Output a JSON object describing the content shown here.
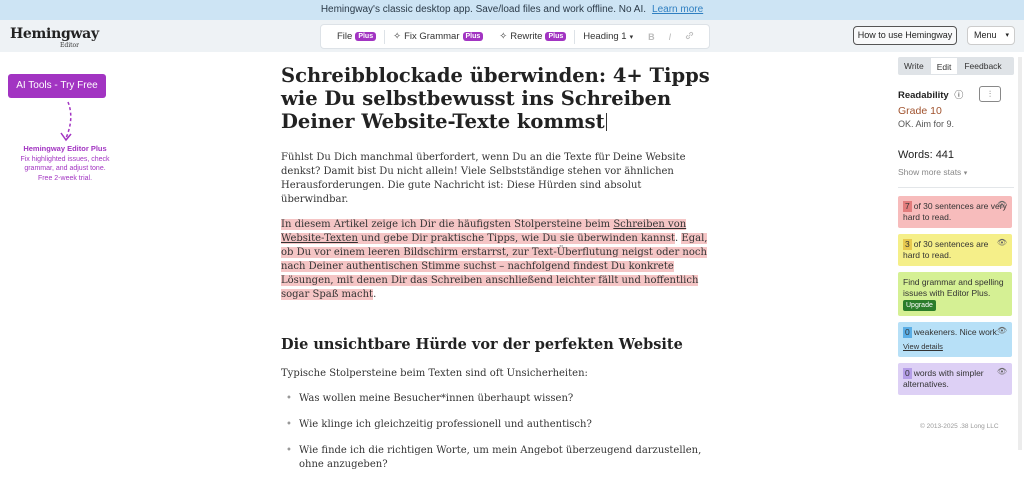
{
  "banner": {
    "text": "Hemingway's classic desktop app. Save/load files and work offline. No AI.",
    "link": "Learn more"
  },
  "logo": {
    "name": "Hemingway",
    "sub": "Editor"
  },
  "toolbar": {
    "file": "File",
    "fix_grammar": "Fix Grammar",
    "rewrite": "Rewrite",
    "plus": "Plus",
    "heading": "Heading 1",
    "bold": "B",
    "italic": "I",
    "link_icon": "link-icon"
  },
  "header": {
    "howto": "How to use Hemingway",
    "menu": "Menu"
  },
  "promo": {
    "button": "AI Tools - Try Free",
    "title": "Hemingway Editor Plus",
    "text": "Fix highlighted issues, check grammar, and adjust tone.",
    "trial": "Free 2-week trial."
  },
  "doc": {
    "title": "Schreibblockade überwinden: 4+ Tipps wie Du selbstbewusst ins Schreiben Deiner Website-Texte kommst",
    "p1": "Fühlst Du Dich manchmal überfordert, wenn Du an die Texte für Deine Website denkst? Damit bist Du nicht allein! Viele Selbstständige stehen vor ähnlichen Herausforderungen. Die gute Nachricht ist: Diese Hürden sind absolut überwindbar.",
    "p2_a": "In diesem Artikel zeige ich Dir die häufigsten Stolpersteine beim ",
    "p2_link": "Schreiben von Website-Texten",
    "p2_b": " und gebe Dir praktische Tipps, wie Du sie überwinden kannst",
    "p2_c": ". ",
    "p2_d": "Egal, ob Du vor einem leeren Bildschirm erstarrst, zur Text-Überflutung neigst oder noch nach Deiner authentischen Stimme suchst – nachfolgend findest Du konkrete Lösungen, mit denen Dir das Schreiben anschließend leichter fällt und hoffentlich sogar Spaß macht",
    "p2_e": ".",
    "h2": "Die unsichtbare Hürde vor der perfekten Website",
    "p3": "Typische Stolpersteine beim Texten sind oft Unsicherheiten:",
    "bullets": [
      "Was wollen meine Besucher*innen überhaupt wissen?",
      "Wie klinge ich gleichzeitig professionell und authentisch?",
      "Wie finde ich die richtigen Worte, um mein Angebot überzeugend darzustellen, ohne anzugeben?"
    ]
  },
  "sidebar": {
    "tabs": [
      "Write",
      "Edit",
      "Feedback"
    ],
    "readability_label": "Readability",
    "grade": "Grade 10",
    "aim": "OK. Aim for 9.",
    "words": "Words: 441",
    "more_stats": "Show more stats",
    "cards": {
      "very_hard_num": "7",
      "very_hard_text": "of 30 sentences are very hard to read.",
      "hard_num": "3",
      "hard_text": "of 30 sentences are hard to read.",
      "grammar_text": "Find grammar and spelling issues with Editor Plus.",
      "upgrade": "Upgrade",
      "weak_num": "0",
      "weak_text": "weakeners. Nice work.",
      "view_details": "View details",
      "simpler_num": "0",
      "simpler_text": "words with simpler alternatives."
    },
    "copyright": "© 2013-2025 .38 Long LLC"
  },
  "colors": {
    "accent": "#a234c2",
    "very_hard": "#f7bcbc",
    "hard": "#f5ef89",
    "grammar": "#d5f094",
    "weakeners": "#b7e0f7",
    "simpler": "#ddd0f5"
  }
}
